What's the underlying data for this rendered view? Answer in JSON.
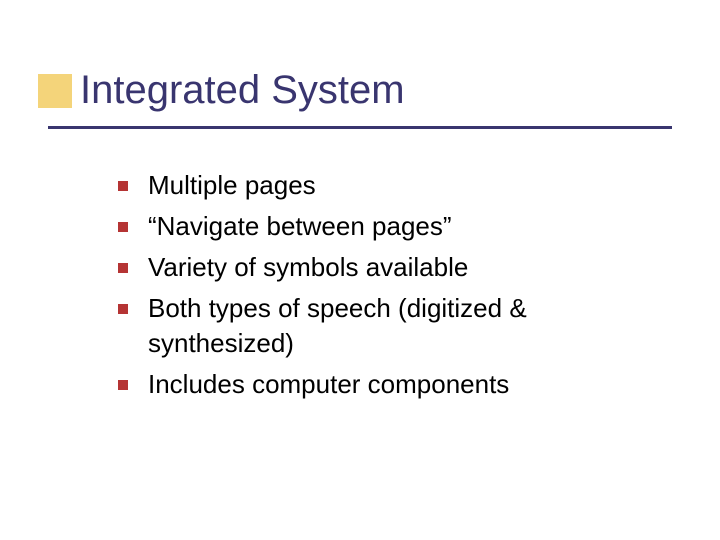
{
  "slide": {
    "title": "Integrated System",
    "bullets": [
      "Multiple pages",
      "“Navigate between pages”",
      "Variety of symbols available",
      "Both types of speech (digitized & synthesized)",
      "Includes computer components"
    ]
  },
  "colors": {
    "title": "#39356f",
    "rule": "#39356f",
    "accent_block": "#f4d47a",
    "bullet": "#b53434"
  }
}
